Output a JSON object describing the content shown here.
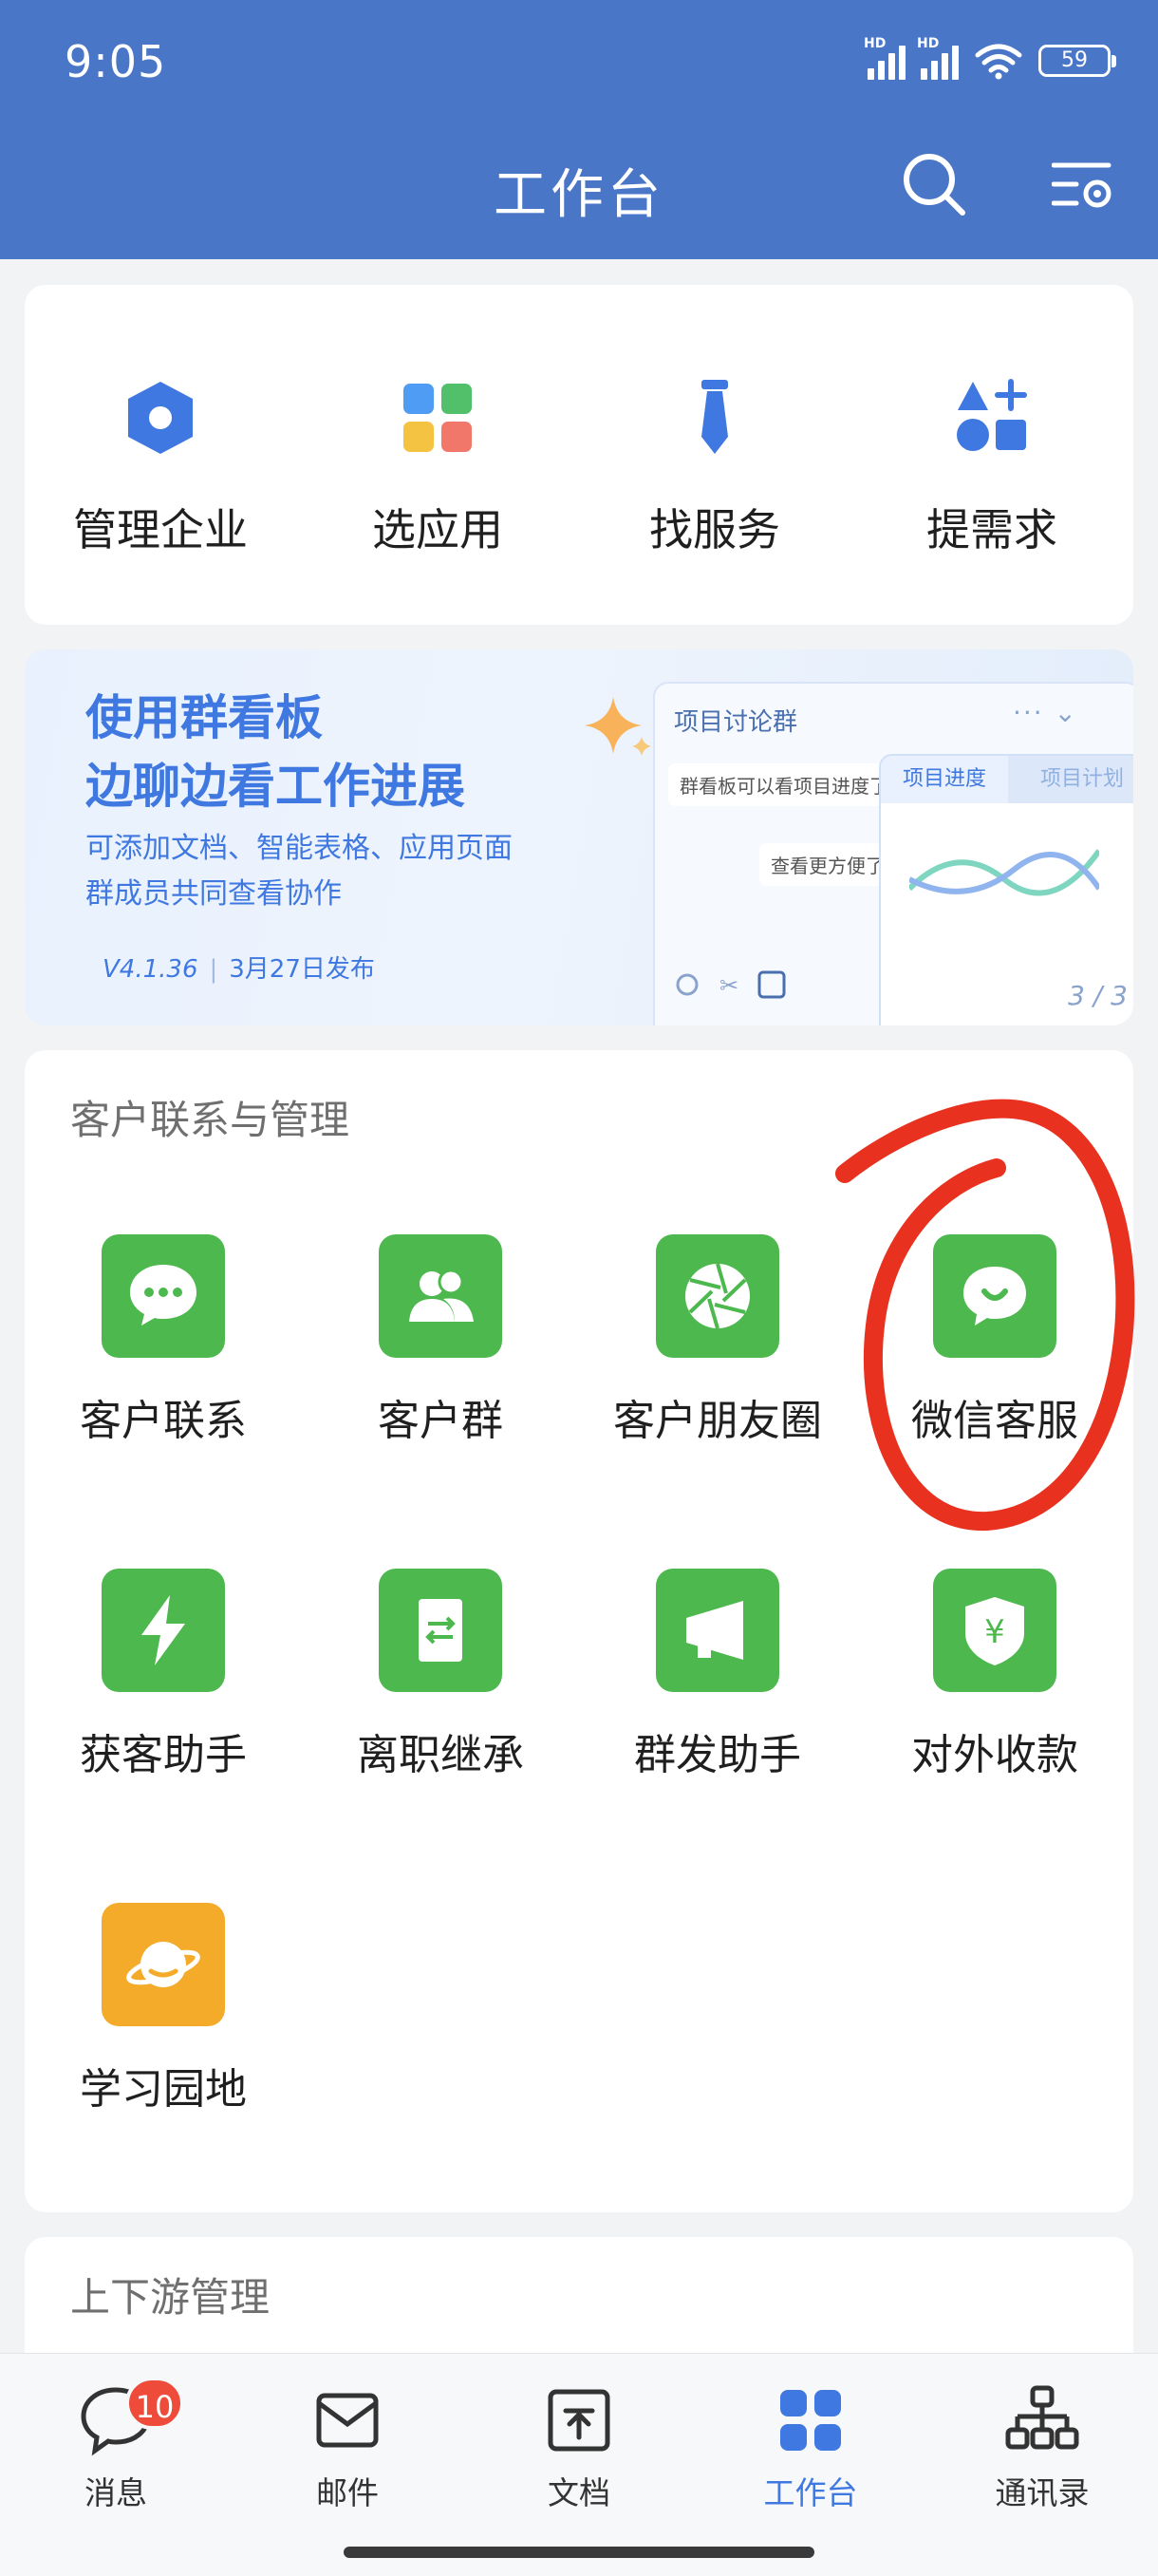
{
  "status": {
    "time": "9:05",
    "hd1": "HD",
    "hd2": "HD",
    "battery": "59"
  },
  "header": {
    "title": "工作台"
  },
  "quick_actions": [
    {
      "label": "管理企业",
      "icon": "hexagon-icon"
    },
    {
      "label": "选应用",
      "icon": "app-grid-icon"
    },
    {
      "label": "找服务",
      "icon": "tie-icon"
    },
    {
      "label": "提需求",
      "icon": "shapes-plus-icon"
    }
  ],
  "banner": {
    "title1": "使用群看板",
    "title2": "边聊边看工作进展",
    "sub1": "可添加文档、智能表格、应用页面",
    "sub2": "群成员共同查看协作",
    "version": "V4.1.36",
    "date": "3月27日发布",
    "mock_title": "项目讨论群",
    "mock_msg1": "群看板可以看项目进度了",
    "mock_msg2": "查看更方便了",
    "mock_tab1": "项目进度",
    "mock_tab2": "项目计划",
    "mock_page": "3 / 3"
  },
  "customer_section": {
    "title": "客户联系与管理",
    "apps": [
      {
        "label": "客户联系",
        "icon": "chat-bubble-icon"
      },
      {
        "label": "客户群",
        "icon": "group-users-icon"
      },
      {
        "label": "客户朋友圈",
        "icon": "aperture-icon"
      },
      {
        "label": "微信客服",
        "icon": "smile-bubble-icon"
      },
      {
        "label": "获客助手",
        "icon": "lightning-icon"
      },
      {
        "label": "离职继承",
        "icon": "transfer-doc-icon"
      },
      {
        "label": "群发助手",
        "icon": "megaphone-icon"
      },
      {
        "label": "对外收款",
        "icon": "yuan-shield-icon"
      },
      {
        "label": "学习园地",
        "icon": "planet-icon"
      }
    ]
  },
  "downstream_section": {
    "title": "上下游管理"
  },
  "tabbar": {
    "tabs": [
      {
        "label": "消息",
        "badge": "10"
      },
      {
        "label": "邮件"
      },
      {
        "label": "文档"
      },
      {
        "label": "工作台"
      },
      {
        "label": "通讯录"
      }
    ],
    "active": "工作台"
  },
  "colors": {
    "header": "#4a76c8",
    "accent": "#3f78e0",
    "app_green": "#4cb84e",
    "app_yellow": "#f5ab2a",
    "annotation_red": "#e8321f",
    "badge": "#ef4b3b"
  }
}
